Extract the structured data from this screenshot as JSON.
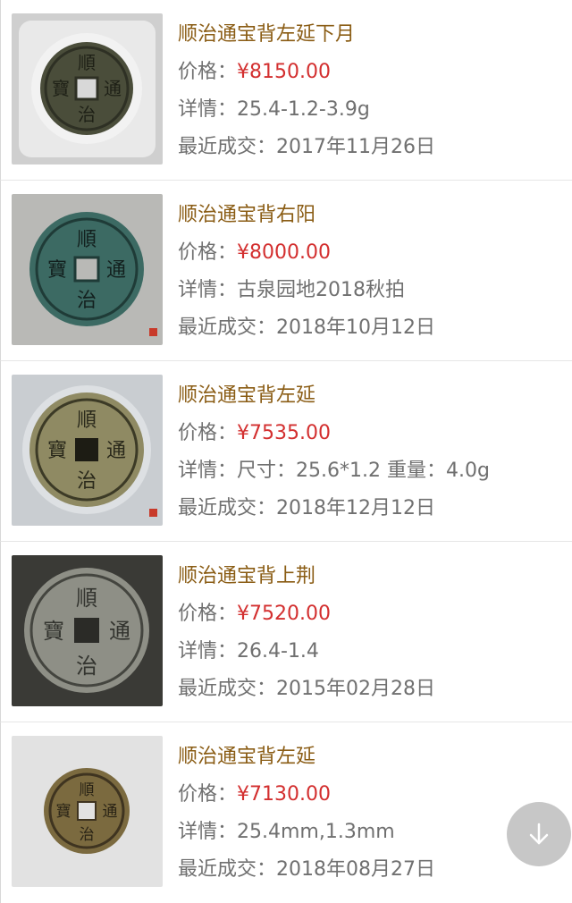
{
  "listings": [
    {
      "title": "顺治通宝背左延下月",
      "price_label": "价格：",
      "price": "¥8150.00",
      "detail_label": "详情：",
      "detail": "25.4-1.2-3.9g",
      "date_label": "最近成交：",
      "date": "2017年11月26日",
      "coin_chars": [
        "順",
        "通",
        "寶",
        "治"
      ]
    },
    {
      "title": "顺治通宝背右阳",
      "price_label": "价格：",
      "price": "¥8000.00",
      "detail_label": "详情：",
      "detail": "古泉园地2018秋拍",
      "date_label": "最近成交：",
      "date": "2018年10月12日",
      "coin_chars": [
        "順",
        "通",
        "寶",
        "治"
      ]
    },
    {
      "title": "顺治通宝背左延",
      "price_label": "价格：",
      "price": "¥7535.00",
      "detail_label": "详情：",
      "detail": "尺寸：25.6*1.2 重量：4.0g",
      "date_label": "最近成交：",
      "date": "2018年12月12日",
      "coin_chars": [
        "順",
        "通",
        "寶",
        "治"
      ]
    },
    {
      "title": "顺治通宝背上荆",
      "price_label": "价格：",
      "price": "¥7520.00",
      "detail_label": "详情：",
      "detail": "26.4-1.4",
      "date_label": "最近成交：",
      "date": "2015年02月28日",
      "coin_chars": [
        "順",
        "通",
        "寶",
        "治"
      ]
    },
    {
      "title": "顺治通宝背左延",
      "price_label": "价格：",
      "price": "¥7130.00",
      "detail_label": "详情：",
      "detail": "25.4mm,1.3mm",
      "date_label": "最近成交：",
      "date": "2018年08月27日",
      "coin_chars": [
        "順",
        "通",
        "寶",
        "治"
      ]
    }
  ],
  "scroll_button_icon": "arrow-down-icon",
  "colors": {
    "title": "#8a5c14",
    "price": "#d32f2f",
    "text": "#707070"
  }
}
